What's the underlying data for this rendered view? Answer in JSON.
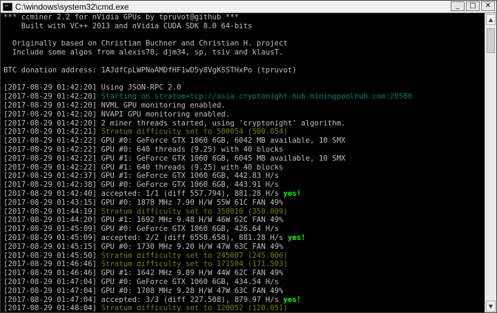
{
  "window": {
    "title": "C:\\windows\\system32\\cmd.exe",
    "buttons": {
      "minimize": "_",
      "maximize": "□",
      "close": "✕"
    }
  },
  "console_lines": [
    [
      {
        "t": "*** ccminer 2.2 for nVidia GPUs by tpruvot@github ***",
        "c": "info"
      }
    ],
    [
      {
        "t": "    Built with VC++ 2013 and nVidia CUDA SDK 8.0 64-bits",
        "c": "info"
      }
    ],
    [
      {
        "t": "",
        "c": "info"
      }
    ],
    [
      {
        "t": "  Originally based on Christian Buchner and Christian H. project",
        "c": "info"
      }
    ],
    [
      {
        "t": "  Include some algos from alexis78, djm34, sp, tsiv and klausT.",
        "c": "info"
      }
    ],
    [
      {
        "t": "",
        "c": "info"
      }
    ],
    [
      {
        "t": "BTC donation address: 1AJdfCpLWPNoAMDfHF1wD5y8VgKSSTHxPo (tpruvot)",
        "c": "info"
      }
    ],
    [
      {
        "t": "",
        "c": "info"
      }
    ],
    [
      {
        "t": "[2017-08-29 01:42:20] Using JSON-RPC 2.0",
        "c": "info"
      }
    ],
    [
      {
        "t": "[2017-08-29 01:42:20] ",
        "c": "info"
      },
      {
        "t": "Starting on stratum+tcp://asia.cryptonight-hub.miningpoolhub.com:20580",
        "c": "cyan"
      }
    ],
    [
      {
        "t": "[2017-08-29 01:42:20] NVML GPU monitoring enabled.",
        "c": "info"
      }
    ],
    [
      {
        "t": "[2017-08-29 01:42:20] NVAPI GPU monitoring enabled.",
        "c": "info"
      }
    ],
    [
      {
        "t": "[2017-08-29 01:42:20] 2 miner threads started, using 'cryptonight' algorithm.",
        "c": "info"
      }
    ],
    [
      {
        "t": "[2017-08-29 01:42:21] ",
        "c": "info"
      },
      {
        "t": "Stratum difficulty set to 500054 (500.054)",
        "c": "yellow"
      }
    ],
    [
      {
        "t": "[2017-08-29 01:42:22] GPU #0: GeForce GTX 1060 6GB, 6042 MB available, 10 SMX",
        "c": "info"
      }
    ],
    [
      {
        "t": "[2017-08-29 01:42:22] GPU #0: 640 threads (9.25) with 40 blocks",
        "c": "info"
      }
    ],
    [
      {
        "t": "[2017-08-29 01:42:22] GPU #1: GeForce GTX 1060 6GB, 6045 MB available, 10 SMX",
        "c": "info"
      }
    ],
    [
      {
        "t": "[2017-08-29 01:42:22] GPU #1: 640 threads (9.25) with 40 blocks",
        "c": "info"
      }
    ],
    [
      {
        "t": "[2017-08-29 01:42:37] GPU #1: GeForce GTX 1060 6GB, 442.83 H/s",
        "c": "info"
      }
    ],
    [
      {
        "t": "[2017-08-29 01:42:38] GPU #0: GeForce GTX 1060 6GB, 443.91 H/s",
        "c": "info"
      }
    ],
    [
      {
        "t": "[2017-08-29 01:42:40] accepted: 1/1 (diff 557.794), 881.28 H/s ",
        "c": "info"
      },
      {
        "t": "yes!",
        "c": "green"
      }
    ],
    [
      {
        "t": "[2017-08-29 01:43:15] GPU #0: 1878 MHz 7.90 H/W 55W 61C FAN 49%",
        "c": "info"
      }
    ],
    [
      {
        "t": "[2017-08-29 01:44:19] ",
        "c": "info"
      },
      {
        "t": "Stratum difficulty set to 350010 (350.009)",
        "c": "yellow"
      }
    ],
    [
      {
        "t": "[2017-08-29 01:44:20] GPU #1: 1692 MHz 9.48 H/W 46W 62C FAN 49%",
        "c": "info"
      }
    ],
    [
      {
        "t": "[2017-08-29 01:45:09] GPU #0: GeForce GTX 1060 6GB, 426.64 H/s",
        "c": "info"
      }
    ],
    [
      {
        "t": "[2017-08-29 01:45:09] accepted: 2/2 (diff 6558.658), 881.28 H/s ",
        "c": "info"
      },
      {
        "t": "yes!",
        "c": "green"
      }
    ],
    [
      {
        "t": "[2017-08-29 01:45:15] GPU #0: 1730 MHz 9.20 H/W 47W 63C FAN 49%",
        "c": "info"
      }
    ],
    [
      {
        "t": "[2017-08-29 01:45:50] ",
        "c": "info"
      },
      {
        "t": "Stratum difficulty set to 245007 (245.006)",
        "c": "yellow"
      }
    ],
    [
      {
        "t": "[2017-08-29 01:46:46] ",
        "c": "info"
      },
      {
        "t": "Stratum difficulty set to 171504 (171.503)",
        "c": "yellow"
      }
    ],
    [
      {
        "t": "[2017-08-29 01:46:46] GPU #1: 1642 MHz 9.89 H/W 44W 62C FAN 49%",
        "c": "info"
      }
    ],
    [
      {
        "t": "[2017-08-29 01:47:04] GPU #0: GeForce GTX 1060 6GB, 434.54 H/s",
        "c": "info"
      }
    ],
    [
      {
        "t": "[2017-08-29 01:47:04] GPU #0: 1708 MHz 9.28 H/W 47W 63C FAN 49%",
        "c": "info"
      }
    ],
    [
      {
        "t": "[2017-08-29 01:47:04] accepted: 3/3 (diff 227.508), 879.97 H/s ",
        "c": "info"
      },
      {
        "t": "yes!",
        "c": "green"
      }
    ],
    [
      {
        "t": "[2017-08-29 01:48:04] ",
        "c": "info"
      },
      {
        "t": "Stratum difficulty set to 120052 (120.051)",
        "c": "yellow"
      }
    ]
  ],
  "colors": {
    "background": "#000000",
    "default_text": "#c0c0c0",
    "cyan_text": "#008080",
    "yellow_text": "#808000",
    "green_text": "#00ff00"
  },
  "icons": {
    "app": "cmd-app-icon",
    "scroll_up": "scroll-up-arrow-icon",
    "scroll_down": "scroll-down-arrow-icon"
  }
}
